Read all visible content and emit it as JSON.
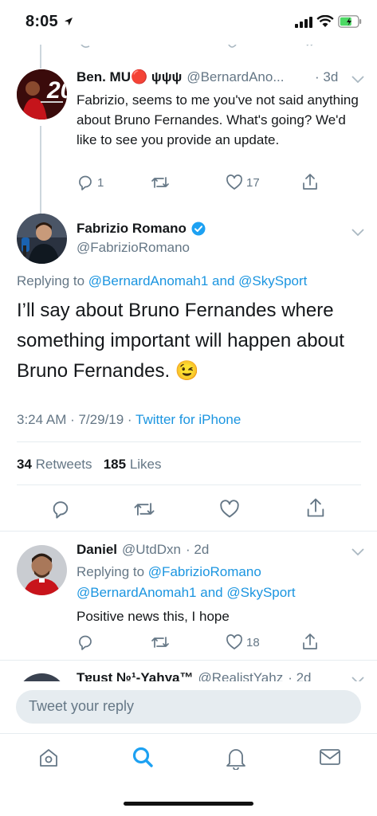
{
  "status_bar": {
    "time": "8:05"
  },
  "parent_tweet": {
    "author_name": "Ben. MU🔴 ψψψ",
    "author_handle": "@BernardAno...",
    "time_ago": "· 3d",
    "text": "Fabrizio, seems to me you've not said anything about Bruno Fernandes. What's going? We'd like to see you provide an update.",
    "reply_count": "1",
    "like_count": "17"
  },
  "main_tweet": {
    "author_name": "Fabrizio Romano",
    "author_handle": "@FabrizioRomano",
    "replying_prefix": "Replying to",
    "replying_user1": "@BernardAnomah1",
    "replying_and": "and",
    "replying_user2": "@SkySport",
    "text": "I’ll say about Bruno Fernandes where something important will happen about Bruno Fernandes. 😉",
    "timestamp": "3:24 AM · 7/29/19 ·",
    "source": "Twitter for iPhone",
    "retweets_count": "34",
    "retweets_label": "Retweets",
    "likes_count": "185",
    "likes_label": "Likes"
  },
  "reply_tweet": {
    "author_name": "Daniel",
    "author_handle": "@UtdDxn",
    "time_ago": "· 2d",
    "replying_prefix": "Replying to",
    "replying_user0": "@FabrizioRomano",
    "replying_user1": "@BernardAnomah1",
    "replying_and": "and",
    "replying_user2": "@SkySport",
    "text": "Positive news this, I hope",
    "like_count": "18"
  },
  "next_tweet": {
    "author_name": "Tɐust №¹-Yahya™",
    "author_handle": "@RealistYahz",
    "time_ago": "· 2d"
  },
  "composer": {
    "placeholder": "Tweet your reply"
  },
  "colors": {
    "accent": "#1b95e0",
    "muted": "#657786",
    "divider": "#e6ecf0",
    "verified": "#1da1f2",
    "battery": "#4cd964"
  },
  "icons": [
    "location-arrow-icon",
    "signal-icon",
    "wifi-icon",
    "battery-icon",
    "chevron-down-icon",
    "reply-icon",
    "retweet-icon",
    "like-icon",
    "share-icon",
    "verified-icon",
    "home-icon",
    "search-icon",
    "notifications-icon",
    "messages-icon"
  ]
}
